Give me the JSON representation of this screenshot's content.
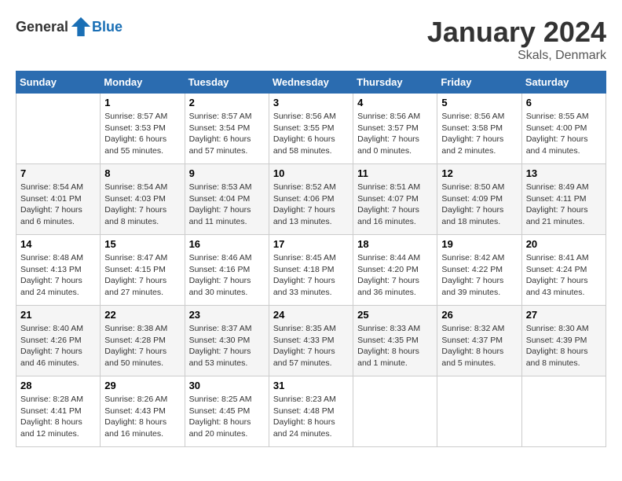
{
  "header": {
    "logo_general": "General",
    "logo_blue": "Blue",
    "month": "January 2024",
    "location": "Skals, Denmark"
  },
  "weekdays": [
    "Sunday",
    "Monday",
    "Tuesday",
    "Wednesday",
    "Thursday",
    "Friday",
    "Saturday"
  ],
  "weeks": [
    [
      {
        "day": "",
        "info": ""
      },
      {
        "day": "1",
        "info": "Sunrise: 8:57 AM\nSunset: 3:53 PM\nDaylight: 6 hours\nand 55 minutes."
      },
      {
        "day": "2",
        "info": "Sunrise: 8:57 AM\nSunset: 3:54 PM\nDaylight: 6 hours\nand 57 minutes."
      },
      {
        "day": "3",
        "info": "Sunrise: 8:56 AM\nSunset: 3:55 PM\nDaylight: 6 hours\nand 58 minutes."
      },
      {
        "day": "4",
        "info": "Sunrise: 8:56 AM\nSunset: 3:57 PM\nDaylight: 7 hours\nand 0 minutes."
      },
      {
        "day": "5",
        "info": "Sunrise: 8:56 AM\nSunset: 3:58 PM\nDaylight: 7 hours\nand 2 minutes."
      },
      {
        "day": "6",
        "info": "Sunrise: 8:55 AM\nSunset: 4:00 PM\nDaylight: 7 hours\nand 4 minutes."
      }
    ],
    [
      {
        "day": "7",
        "info": "Sunrise: 8:54 AM\nSunset: 4:01 PM\nDaylight: 7 hours\nand 6 minutes."
      },
      {
        "day": "8",
        "info": "Sunrise: 8:54 AM\nSunset: 4:03 PM\nDaylight: 7 hours\nand 8 minutes."
      },
      {
        "day": "9",
        "info": "Sunrise: 8:53 AM\nSunset: 4:04 PM\nDaylight: 7 hours\nand 11 minutes."
      },
      {
        "day": "10",
        "info": "Sunrise: 8:52 AM\nSunset: 4:06 PM\nDaylight: 7 hours\nand 13 minutes."
      },
      {
        "day": "11",
        "info": "Sunrise: 8:51 AM\nSunset: 4:07 PM\nDaylight: 7 hours\nand 16 minutes."
      },
      {
        "day": "12",
        "info": "Sunrise: 8:50 AM\nSunset: 4:09 PM\nDaylight: 7 hours\nand 18 minutes."
      },
      {
        "day": "13",
        "info": "Sunrise: 8:49 AM\nSunset: 4:11 PM\nDaylight: 7 hours\nand 21 minutes."
      }
    ],
    [
      {
        "day": "14",
        "info": "Sunrise: 8:48 AM\nSunset: 4:13 PM\nDaylight: 7 hours\nand 24 minutes."
      },
      {
        "day": "15",
        "info": "Sunrise: 8:47 AM\nSunset: 4:15 PM\nDaylight: 7 hours\nand 27 minutes."
      },
      {
        "day": "16",
        "info": "Sunrise: 8:46 AM\nSunset: 4:16 PM\nDaylight: 7 hours\nand 30 minutes."
      },
      {
        "day": "17",
        "info": "Sunrise: 8:45 AM\nSunset: 4:18 PM\nDaylight: 7 hours\nand 33 minutes."
      },
      {
        "day": "18",
        "info": "Sunrise: 8:44 AM\nSunset: 4:20 PM\nDaylight: 7 hours\nand 36 minutes."
      },
      {
        "day": "19",
        "info": "Sunrise: 8:42 AM\nSunset: 4:22 PM\nDaylight: 7 hours\nand 39 minutes."
      },
      {
        "day": "20",
        "info": "Sunrise: 8:41 AM\nSunset: 4:24 PM\nDaylight: 7 hours\nand 43 minutes."
      }
    ],
    [
      {
        "day": "21",
        "info": "Sunrise: 8:40 AM\nSunset: 4:26 PM\nDaylight: 7 hours\nand 46 minutes."
      },
      {
        "day": "22",
        "info": "Sunrise: 8:38 AM\nSunset: 4:28 PM\nDaylight: 7 hours\nand 50 minutes."
      },
      {
        "day": "23",
        "info": "Sunrise: 8:37 AM\nSunset: 4:30 PM\nDaylight: 7 hours\nand 53 minutes."
      },
      {
        "day": "24",
        "info": "Sunrise: 8:35 AM\nSunset: 4:33 PM\nDaylight: 7 hours\nand 57 minutes."
      },
      {
        "day": "25",
        "info": "Sunrise: 8:33 AM\nSunset: 4:35 PM\nDaylight: 8 hours\nand 1 minute."
      },
      {
        "day": "26",
        "info": "Sunrise: 8:32 AM\nSunset: 4:37 PM\nDaylight: 8 hours\nand 5 minutes."
      },
      {
        "day": "27",
        "info": "Sunrise: 8:30 AM\nSunset: 4:39 PM\nDaylight: 8 hours\nand 8 minutes."
      }
    ],
    [
      {
        "day": "28",
        "info": "Sunrise: 8:28 AM\nSunset: 4:41 PM\nDaylight: 8 hours\nand 12 minutes."
      },
      {
        "day": "29",
        "info": "Sunrise: 8:26 AM\nSunset: 4:43 PM\nDaylight: 8 hours\nand 16 minutes."
      },
      {
        "day": "30",
        "info": "Sunrise: 8:25 AM\nSunset: 4:45 PM\nDaylight: 8 hours\nand 20 minutes."
      },
      {
        "day": "31",
        "info": "Sunrise: 8:23 AM\nSunset: 4:48 PM\nDaylight: 8 hours\nand 24 minutes."
      },
      {
        "day": "",
        "info": ""
      },
      {
        "day": "",
        "info": ""
      },
      {
        "day": "",
        "info": ""
      }
    ]
  ]
}
